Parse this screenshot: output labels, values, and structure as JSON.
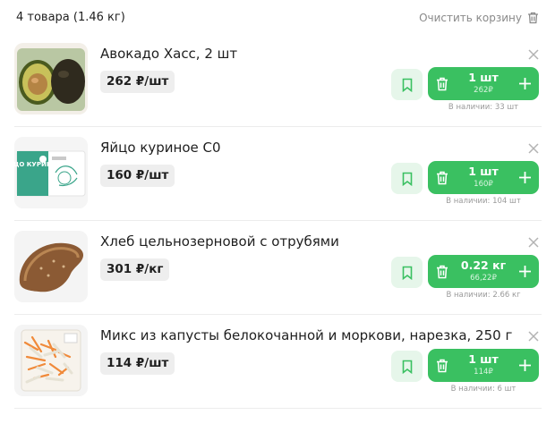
{
  "cart": {
    "summary": "4 товара (1.46 кг)",
    "clear_label": "Очистить корзину"
  },
  "items": [
    {
      "name": "Авокадо Хасс, 2 шт",
      "price": "262 ₽/шт",
      "qty": "1 шт",
      "sum": "262₽",
      "stock": "В наличии: 33 шт"
    },
    {
      "name": "Яйцо куриное С0",
      "price": "160 ₽/шт",
      "qty": "1 шт",
      "sum": "160₽",
      "stock": "В наличии: 104 шт",
      "package_text": "ЯЙЦО КУРИНОЕ"
    },
    {
      "name": "Хлеб цельнозерновой с отрубями",
      "price": "301 ₽/кг",
      "qty": "0.22 кг",
      "sum": "66,22₽",
      "stock": "В наличии: 2.66 кг"
    },
    {
      "name": "Микс из капусты белокочанной и моркови, нарезка, 250 г",
      "price": "114 ₽/шт",
      "qty": "1 шт",
      "sum": "114₽",
      "stock": "В наличии: 6 шт"
    }
  ],
  "colors": {
    "accent": "#3ac061",
    "fav_bg": "#e6f6ea",
    "price_bg": "#eeeeee"
  }
}
